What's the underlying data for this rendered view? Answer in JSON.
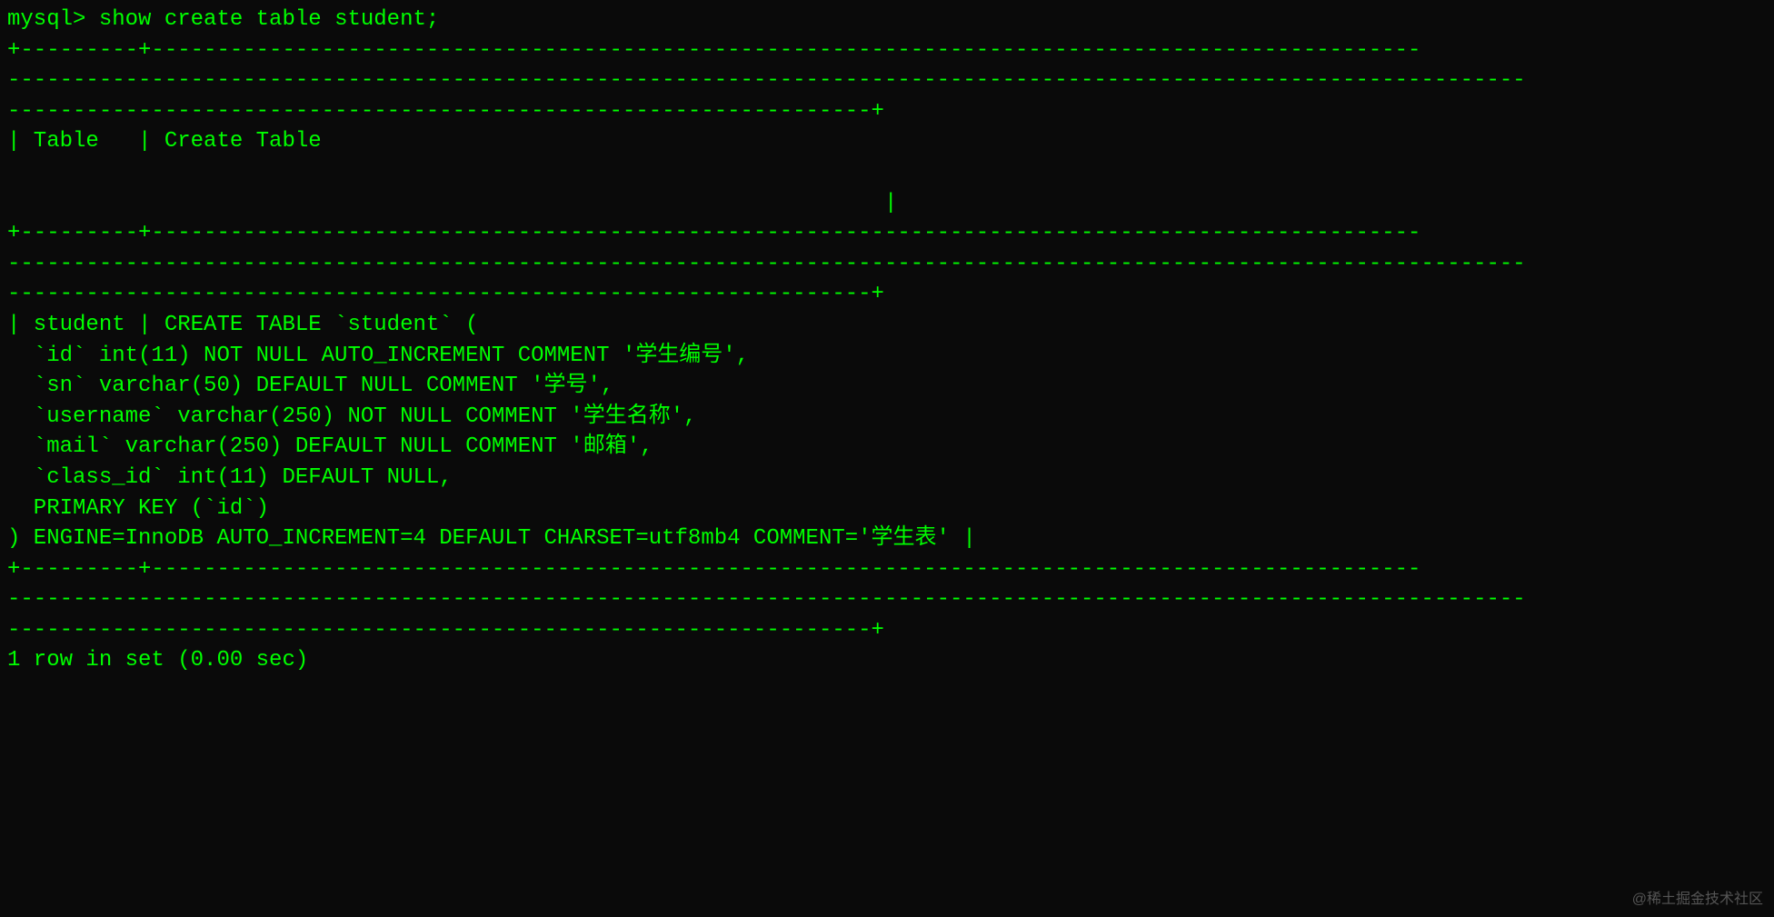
{
  "terminal": {
    "prompt": "mysql>",
    "command": "show create table student;",
    "border_top_line1": "+---------+-------------------------------------------------------------------------------------------------",
    "border_line2": "--------------------------------------------------------------------------------------------------------------------",
    "border_line3": "------------------------------------------------------------------+",
    "header_row": "| Table   | Create Table",
    "header_blank_pipe": "                                                                   |",
    "border_mid_line1": "+---------+-------------------------------------------------------------------------------------------------",
    "data_row1": "| student | CREATE TABLE `student` (",
    "data_row2": "  `id` int(11) NOT NULL AUTO_INCREMENT COMMENT '学生编号',",
    "data_row3": "  `sn` varchar(50) DEFAULT NULL COMMENT '学号',",
    "data_row4": "  `username` varchar(250) NOT NULL COMMENT '学生名称',",
    "data_row5": "  `mail` varchar(250) DEFAULT NULL COMMENT '邮箱',",
    "data_row6": "  `class_id` int(11) DEFAULT NULL,",
    "data_row7": "  PRIMARY KEY (`id`)",
    "data_row8": ") ENGINE=InnoDB AUTO_INCREMENT=4 DEFAULT CHARSET=utf8mb4 COMMENT='学生表'",
    "data_row8_end": " |",
    "border_bottom_line1": "+---------+-------------------------------------------------------------------------------------------------",
    "result_summary": "1 row in set (0.00 sec)"
  },
  "watermark": "@稀土掘金技术社区"
}
